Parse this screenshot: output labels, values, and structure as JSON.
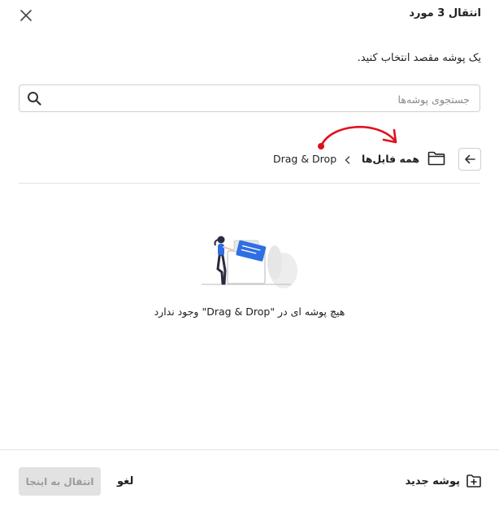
{
  "dialog": {
    "title": "انتقال 3 مورد",
    "subtitle": "یک پوشه مقصد انتخاب کنید."
  },
  "search": {
    "placeholder": "جستجوی پوشه‌ها",
    "value": ""
  },
  "breadcrumb": {
    "root_label": "همه فایل‌ها",
    "current_label": "Drag & Drop"
  },
  "empty_state": {
    "message": "هیچ پوشه ای در \"Drag & Drop\" وجود ندارد"
  },
  "footer": {
    "new_folder_label": "پوشه جدید",
    "cancel_label": "لغو",
    "move_here_label": "انتقال به اینجا",
    "move_here_enabled": false
  },
  "icons": {
    "close": "close-icon",
    "search": "search-icon",
    "back": "arrow-left-icon",
    "folder": "folder-icon",
    "chevron": "chevron-left-icon",
    "new_folder": "folder-plus-icon"
  },
  "colors": {
    "annotation_arrow": "#e0101b",
    "illustration_blue": "#2f6fe4",
    "disabled_button_bg": "#e2e2e2",
    "disabled_button_text": "#9a9a9a"
  }
}
